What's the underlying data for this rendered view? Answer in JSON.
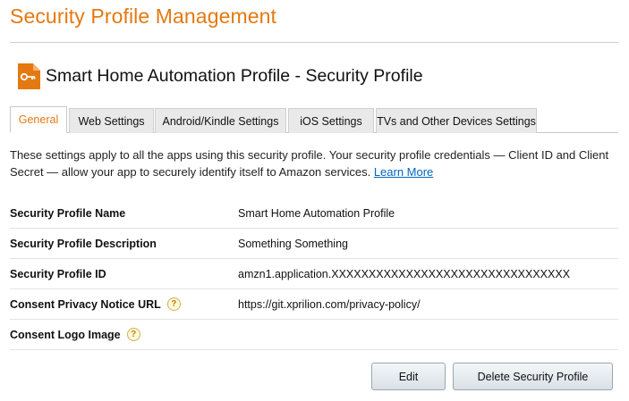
{
  "page": {
    "title": "Security Profile Management"
  },
  "profile": {
    "heading": "Smart Home Automation Profile - Security Profile",
    "icon": "key-icon"
  },
  "tabs": [
    {
      "label": "General",
      "active": true
    },
    {
      "label": "Web Settings",
      "active": false
    },
    {
      "label": "Android/Kindle Settings",
      "active": false
    },
    {
      "label": "iOS Settings",
      "active": false
    },
    {
      "label": "TVs and Other Devices Settings",
      "active": false
    }
  ],
  "description": {
    "text": "These settings apply to all the apps using this security profile. Your security profile credentials — Client ID and Client Secret — allow your app to securely identify itself to Amazon services.",
    "link_label": "Learn More"
  },
  "details": [
    {
      "label": "Security Profile Name",
      "value": "Smart Home Automation Profile",
      "help": false
    },
    {
      "label": "Security Profile Description",
      "value": "Something Something",
      "help": false
    },
    {
      "label": "Security Profile ID",
      "value": "amzn1.application.XXXXXXXXXXXXXXXXXXXXXXXXXXXXXXXX",
      "help": false
    },
    {
      "label": "Consent Privacy Notice URL",
      "value": "https://git.xprilion.com/privacy-policy/",
      "help": true
    },
    {
      "label": "Consent Logo Image",
      "value": "",
      "help": true
    }
  ],
  "help_glyph": "?",
  "actions": {
    "edit_label": "Edit",
    "delete_label": "Delete Security Profile"
  },
  "colors": {
    "accent": "#e47911",
    "link": "#0066c0"
  }
}
